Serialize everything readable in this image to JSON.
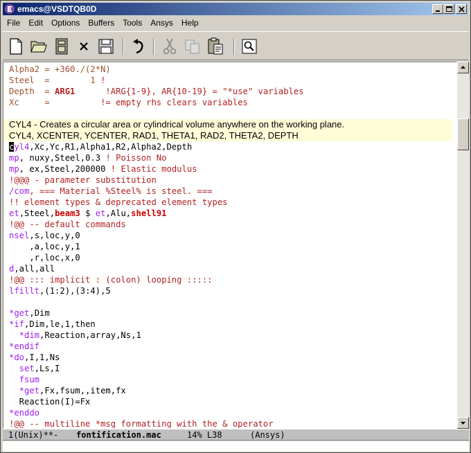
{
  "window": {
    "title": "emacs@VSDTQB0D"
  },
  "menu": [
    "File",
    "Edit",
    "Options",
    "Buffers",
    "Tools",
    "Ansys",
    "Help"
  ],
  "toolbar": {
    "icons": [
      "new-file-icon",
      "open-folder-icon",
      "save-disk-icon",
      "close-x-icon",
      "save-as-icon",
      "undo-icon",
      "cut-icon",
      "copy-icon",
      "paste-icon",
      "search-icon"
    ]
  },
  "editor": {
    "lines": [
      [
        {
          "t": "Alpha2 = +360./(2*N)",
          "c": "c-var"
        }
      ],
      [
        {
          "t": "Steel  =        1 ",
          "c": "c-var"
        },
        {
          "t": "!",
          "c": "c-com"
        }
      ],
      [
        {
          "t": "Depth  = ",
          "c": "c-var"
        },
        {
          "t": "ARG1",
          "c": "c-arg"
        },
        {
          "t": "      !ARG{1-9}, AR{10-19} = \"*use\" variables",
          "c": "c-com"
        }
      ],
      [
        {
          "t": "Xc     =          ",
          "c": "c-var"
        },
        {
          "t": "!= empty rhs clears variables",
          "c": "c-com"
        }
      ],
      [
        {
          "t": "",
          "c": "c-plain"
        }
      ],
      [
        {
          "t": "CYL4 - Creates a circular area or cylindrical volume anywhere on the working plane.",
          "c": "help"
        }
      ],
      [
        {
          "t": "CYL4, XCENTER, YCENTER, RAD1, THETA1, RAD2, THETA2, DEPTH",
          "c": "help"
        }
      ],
      [
        {
          "t": "c",
          "c": "cursor"
        },
        {
          "t": "yl4",
          "c": "c-kw"
        },
        {
          "t": ",Xc,Yc,R1,Alpha1,R2,Alpha2,Depth",
          "c": "c-plain"
        }
      ],
      [
        {
          "t": "mp",
          "c": "c-kw"
        },
        {
          "t": ", nuxy,Steel,0.3 ",
          "c": "c-plain"
        },
        {
          "t": "! Poisson No",
          "c": "c-com"
        }
      ],
      [
        {
          "t": "mp",
          "c": "c-kw"
        },
        {
          "t": ", ex,Steel,200000 ",
          "c": "c-plain"
        },
        {
          "t": "! Elastic modulus",
          "c": "c-com"
        }
      ],
      [
        {
          "t": "!@@@ - parameter substitution",
          "c": "c-com"
        }
      ],
      [
        {
          "t": "/com",
          "c": "c-kw"
        },
        {
          "t": ", === Material %Steel% is steel. ===",
          "c": "c-com"
        }
      ],
      [
        {
          "t": "!! element types & deprecated element types",
          "c": "c-com"
        }
      ],
      [
        {
          "t": "et",
          "c": "c-kw"
        },
        {
          "t": ",Steel,",
          "c": "c-plain"
        },
        {
          "t": "beam3",
          "c": "c-red"
        },
        {
          "t": " $ ",
          "c": "c-plain"
        },
        {
          "t": "et",
          "c": "c-kw"
        },
        {
          "t": ",Alu,",
          "c": "c-plain"
        },
        {
          "t": "shell91",
          "c": "c-red"
        }
      ],
      [
        {
          "t": "!@@ -- default commands",
          "c": "c-com"
        }
      ],
      [
        {
          "t": "nsel",
          "c": "c-kw"
        },
        {
          "t": ",s,loc,y,0",
          "c": "c-plain"
        }
      ],
      [
        {
          "t": "    ,a,loc,y,1",
          "c": "c-plain"
        }
      ],
      [
        {
          "t": "    ,r,loc,x,0",
          "c": "c-plain"
        }
      ],
      [
        {
          "t": "d",
          "c": "c-kw"
        },
        {
          "t": ",all,all",
          "c": "c-plain"
        }
      ],
      [
        {
          "t": "!@@ ::: implicit : (colon) looping :::::",
          "c": "c-com"
        }
      ],
      [
        {
          "t": "lfillt",
          "c": "c-kw"
        },
        {
          "t": ",(1:2),(3:4),5",
          "c": "c-plain"
        }
      ],
      [
        {
          "t": "",
          "c": "c-plain"
        }
      ],
      [
        {
          "t": "*get",
          "c": "c-kw"
        },
        {
          "t": ",Dim",
          "c": "c-plain"
        }
      ],
      [
        {
          "t": "*if",
          "c": "c-kw"
        },
        {
          "t": ",Dim,le,1,then",
          "c": "c-plain"
        }
      ],
      [
        {
          "t": "  *dim",
          "c": "c-kw"
        },
        {
          "t": ",Reaction,array,Ns,1",
          "c": "c-plain"
        }
      ],
      [
        {
          "t": "*endif",
          "c": "c-kw"
        }
      ],
      [
        {
          "t": "*do",
          "c": "c-kw"
        },
        {
          "t": ",I,1,Ns",
          "c": "c-plain"
        }
      ],
      [
        {
          "t": "  set",
          "c": "c-kw"
        },
        {
          "t": ",Ls,I",
          "c": "c-plain"
        }
      ],
      [
        {
          "t": "  fsum",
          "c": "c-kw"
        }
      ],
      [
        {
          "t": "  *get",
          "c": "c-kw"
        },
        {
          "t": ",Fx,fsum,,item,fx",
          "c": "c-plain"
        }
      ],
      [
        {
          "t": "  Reaction(I)=Fx",
          "c": "c-plain"
        }
      ],
      [
        {
          "t": "*enddo",
          "c": "c-kw"
        }
      ],
      [
        {
          "t": "!@@ -- multiline *msg formatting with the & operator",
          "c": "c-com"
        }
      ]
    ]
  },
  "modeline": {
    "status": "1(Unix)**-",
    "buffer": "fontification.mac",
    "position": "14% L38",
    "mode": "(Ansys)"
  }
}
